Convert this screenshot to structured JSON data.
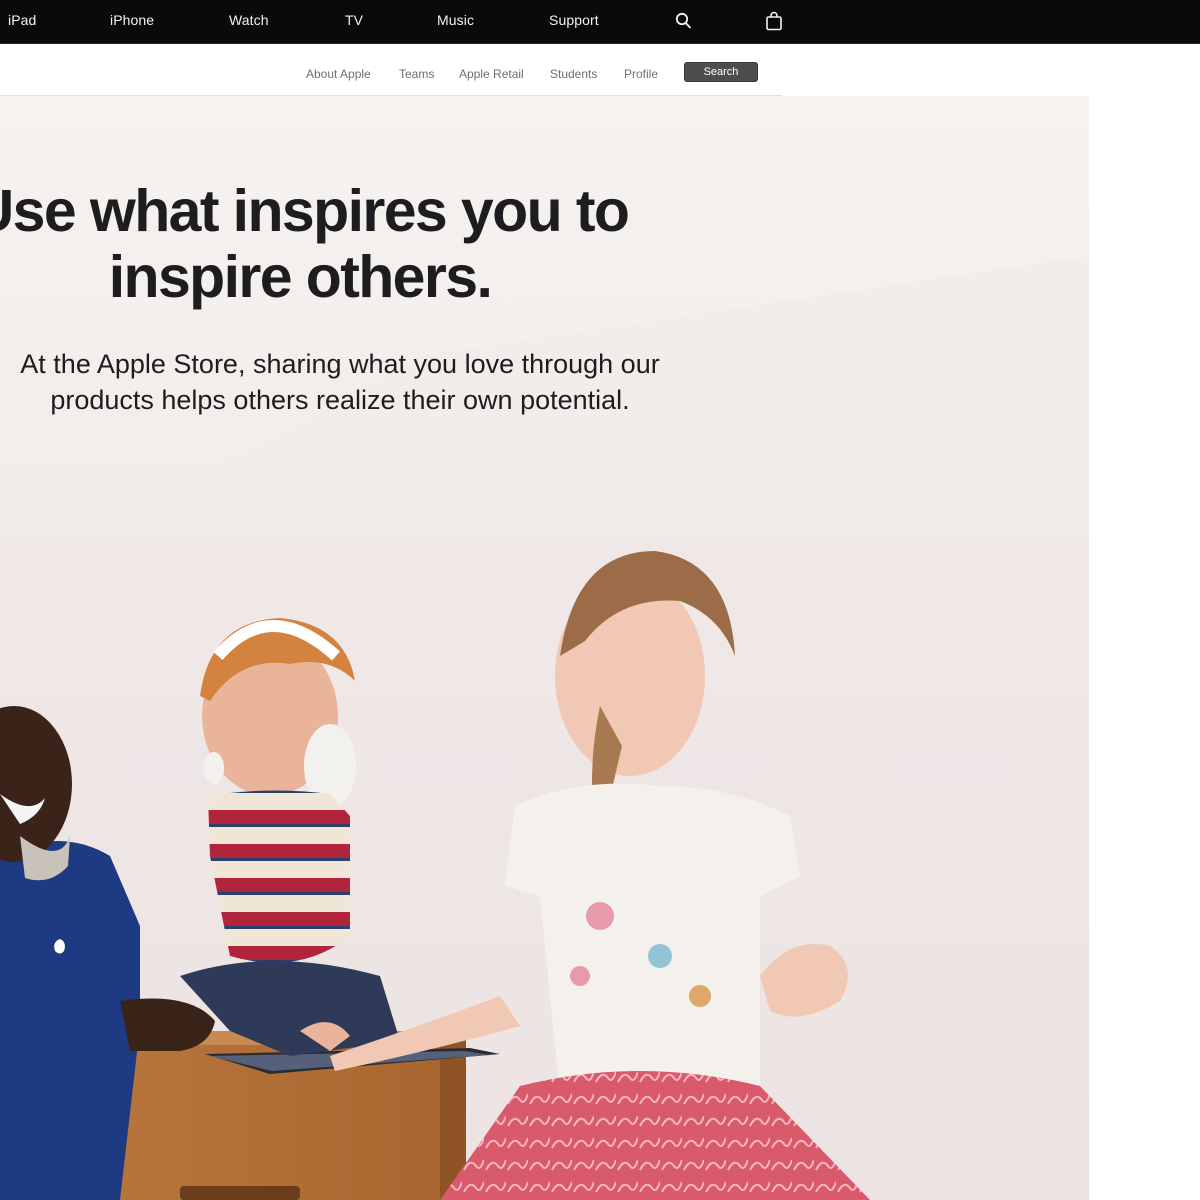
{
  "global_nav": {
    "items": [
      "iPad",
      "iPhone",
      "Watch",
      "TV",
      "Music",
      "Support"
    ],
    "icons": [
      "search-icon",
      "bag-icon"
    ]
  },
  "local_nav": {
    "links": [
      "About Apple",
      "Teams",
      "Apple Retail",
      "Students",
      "Profile"
    ],
    "search_label": "Search"
  },
  "hero": {
    "headline_line1": "Use what inspires you to",
    "headline_line2": "inspire others.",
    "subcopy_line1": "At the Apple Store, sharing what you love through our",
    "subcopy_line2": "products helps others realize their own potential."
  },
  "colors": {
    "nav_bg": "#0a0a0a",
    "hero_bg": "#f4f0ee",
    "text": "#1d1d1f",
    "search_button": "#4d4d4d"
  }
}
